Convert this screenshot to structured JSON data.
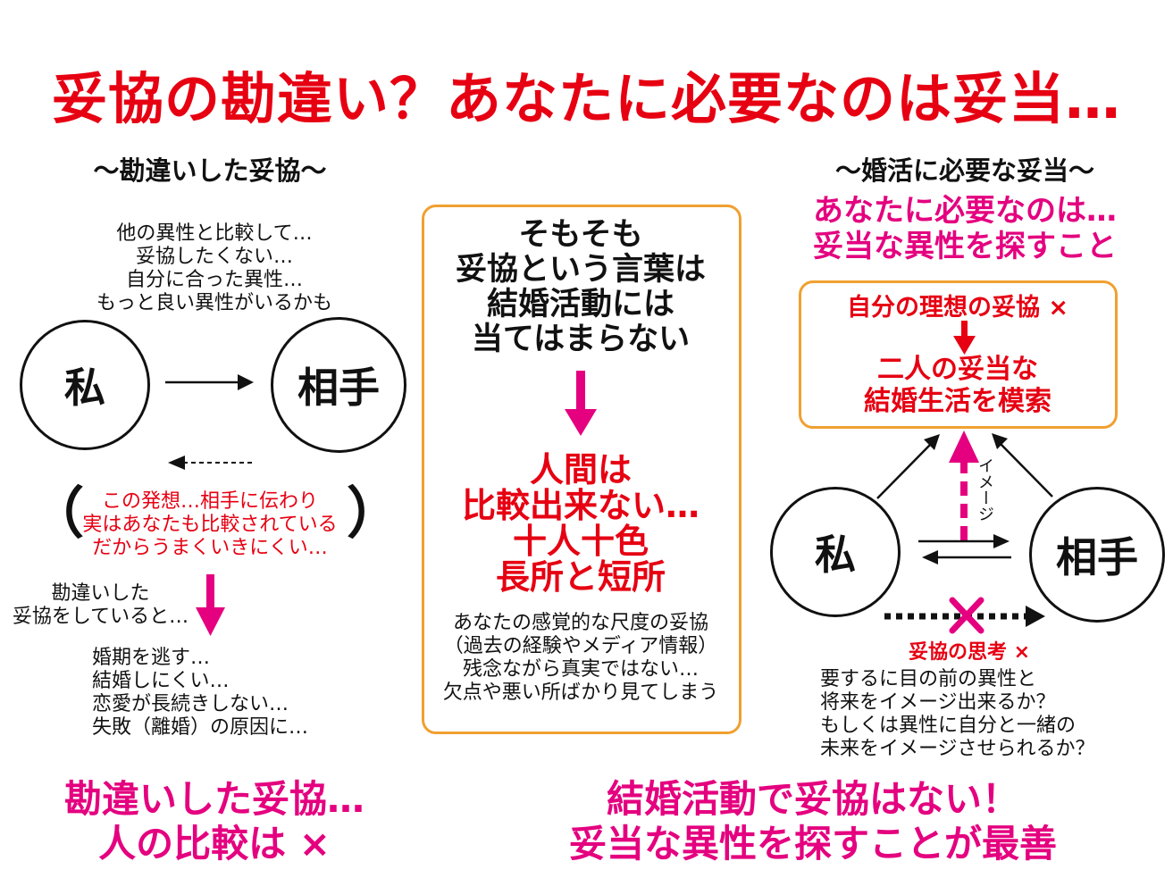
{
  "title": "妥協の勘違い？あなたに必要なのは妥当…",
  "left": {
    "heading": "～勘違いした妥協～",
    "thoughts": [
      "他の異性と比較して…",
      "妥協したくない…",
      "自分に合った異性…",
      "もっと良い異性がいるかも"
    ],
    "me": "私",
    "partner": "相手",
    "bracket_open": "（",
    "bracket_close": "）",
    "notice": [
      "この発想…相手に伝わり",
      "実はあなたも比較されている",
      "だからうまくいきにくい…"
    ],
    "cause": [
      "勘違いした",
      "妥協をしていると…"
    ],
    "results": [
      "婚期を逃す…",
      "結婚しにくい…",
      "恋愛が長続きしない…",
      "失敗（離婚）の原因に…"
    ],
    "conclusion": [
      "勘違いした妥協…",
      "人の比較は ×"
    ]
  },
  "center": {
    "statement": [
      "そもそも",
      "妥協という言葉は",
      "結婚活動には",
      "当てはまらない"
    ],
    "highlight": [
      "人間は",
      "比較出来ない…",
      "十人十色",
      "長所と短所"
    ],
    "note": [
      "あなたの感覚的な尺度の妥協",
      "（過去の経験やメディア情報）",
      "残念ながら真実ではない…",
      "欠点や悪い所ばかり見てしまう"
    ]
  },
  "right": {
    "heading": "～婚活に必要な妥当～",
    "need": [
      "あなたに必要なのは…",
      "妥当な異性を探すこと"
    ],
    "box_top": "自分の理想の妥協 ×",
    "box_bottom": [
      "二人の妥当な",
      "結婚生活を模索"
    ],
    "image_label": "イメージ",
    "me": "私",
    "partner": "相手",
    "wrong": "妥協の思考 ×",
    "questions": [
      "要するに目の前の異性と",
      "将来をイメージ出来るか？",
      "もしくは異性に自分と一緒の",
      "未来をイメージさせられるか？"
    ]
  },
  "bottom_right": [
    "結婚活動で妥協はない！",
    "妥当な異性を探すことが最善"
  ],
  "colors": {
    "red": "#e60012",
    "pink": "#e4007f",
    "orange": "#f0a030",
    "black": "#111111"
  }
}
